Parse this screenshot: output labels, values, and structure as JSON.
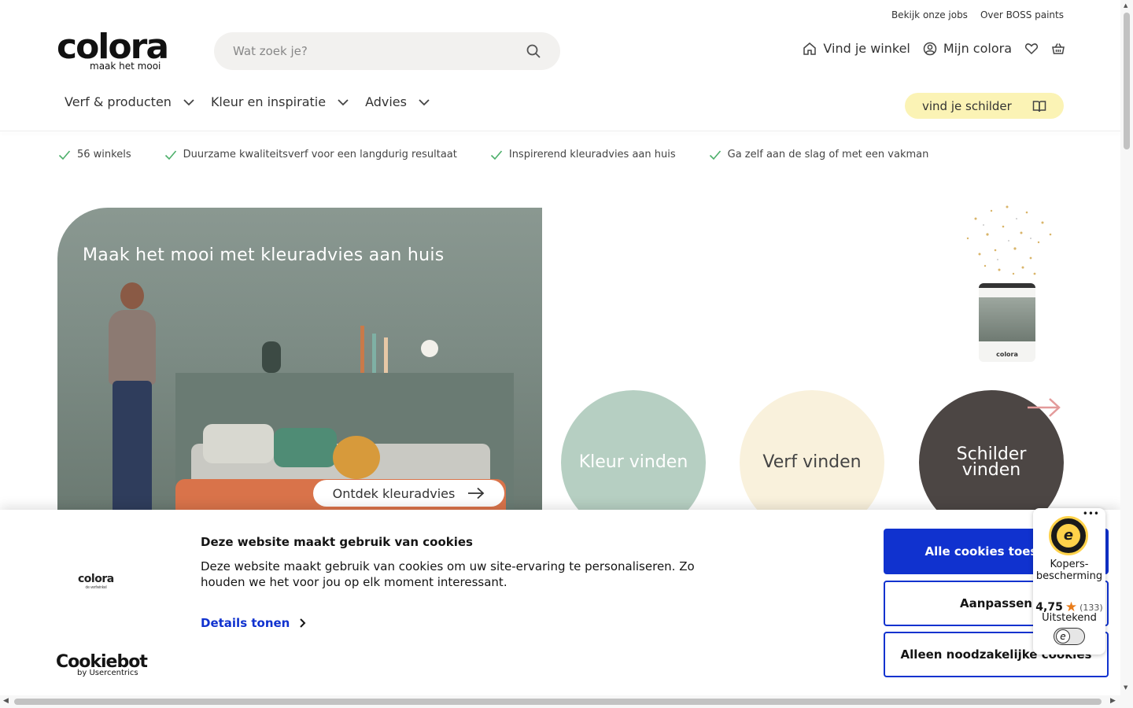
{
  "topbar": {
    "jobs": "Bekijk onze jobs",
    "about": "Over BOSS paints"
  },
  "logo": {
    "word": "colora",
    "tagline": "maak het mooi"
  },
  "search": {
    "placeholder": "Wat zoek je?"
  },
  "header": {
    "store": "Vind je winkel",
    "account": "Mijn colora"
  },
  "nav": [
    {
      "label": "Verf & producten"
    },
    {
      "label": "Kleur en inspiratie"
    },
    {
      "label": "Advies"
    }
  ],
  "painter_button": "vind je schilder",
  "usps": [
    "56 winkels",
    "Duurzame kwaliteitsverf voor een langdurig resultaat",
    "Inspirerend kleuradvies aan huis",
    "Ga zelf aan de slag of met een vakman"
  ],
  "hero": {
    "title": "Maak het mooi met kleuradvies aan huis",
    "cta": "Ontdek kleuradvies"
  },
  "can_brand": "colora",
  "circles": [
    {
      "label": "Kleur vinden",
      "color": "#b6cfc2"
    },
    {
      "label": "Verf vinden",
      "color": "#f9f1dc"
    },
    {
      "label": "Schilder vinden",
      "color": "#4c4644"
    }
  ],
  "cookie": {
    "logo": "colora",
    "logo_sub": "de verfwinkel",
    "title": "Deze website maakt gebruik van cookies",
    "text": "Deze website maakt gebruik van cookies om uw site-ervaring te personaliseren. Zo houden we het voor jou op elk moment interessant.",
    "details": "Details tonen",
    "accept_all": "Alle cookies toestaan",
    "customize": "Aanpassen",
    "necessary": "Alleen noodzakelijke cookies",
    "provider": "Cookiebot",
    "provider_sub": "by Usercentrics"
  },
  "trusted_shops": {
    "label": "Kopers-bescherming",
    "score": "4,75",
    "count": "(133)",
    "verdict": "Uitstekend",
    "seal_letter": "e"
  },
  "colors": {
    "accent_blue": "#1032cf",
    "painter_yellow": "#fbf3b5",
    "star": "#e97c1a"
  }
}
